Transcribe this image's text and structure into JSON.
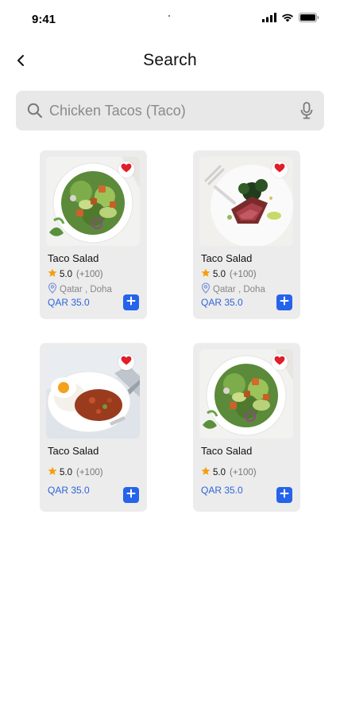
{
  "status_bar": {
    "time": "9:41"
  },
  "header": {
    "title": "Search",
    "back_icon": "chevron-left-icon"
  },
  "search": {
    "value": "Chicken Tacos (Taco)",
    "placeholder": "Chicken Tacos (Taco)",
    "search_icon": "search-icon",
    "mic_icon": "microphone-icon"
  },
  "colors": {
    "accent": "#2563eb",
    "price": "#2f64d8",
    "favorite": "#e11d2a",
    "star": "#f59e0b",
    "card_bg": "#ececec",
    "search_bg": "#e8e8e8"
  },
  "cards": [
    {
      "name": "Taco Salad",
      "rating": "5.0",
      "reviews": "(+100)",
      "location": "Qatar , Doha",
      "price": "QAR 35.0",
      "image": "salad-bowl",
      "favorite": true
    },
    {
      "name": "Taco Salad",
      "rating": "5.0",
      "reviews": "(+100)",
      "location": "Qatar , Doha",
      "price": "QAR 35.0",
      "image": "steak-plate",
      "favorite": true
    },
    {
      "name": "Taco Salad",
      "rating": "5.0",
      "reviews": "(+100)",
      "price": "QAR 35.0",
      "image": "egg-rice-plate",
      "favorite": true
    },
    {
      "name": "Taco Salad",
      "rating": "5.0",
      "reviews": "(+100)",
      "price": "QAR 35.0",
      "image": "salad-bowl",
      "favorite": true
    }
  ]
}
